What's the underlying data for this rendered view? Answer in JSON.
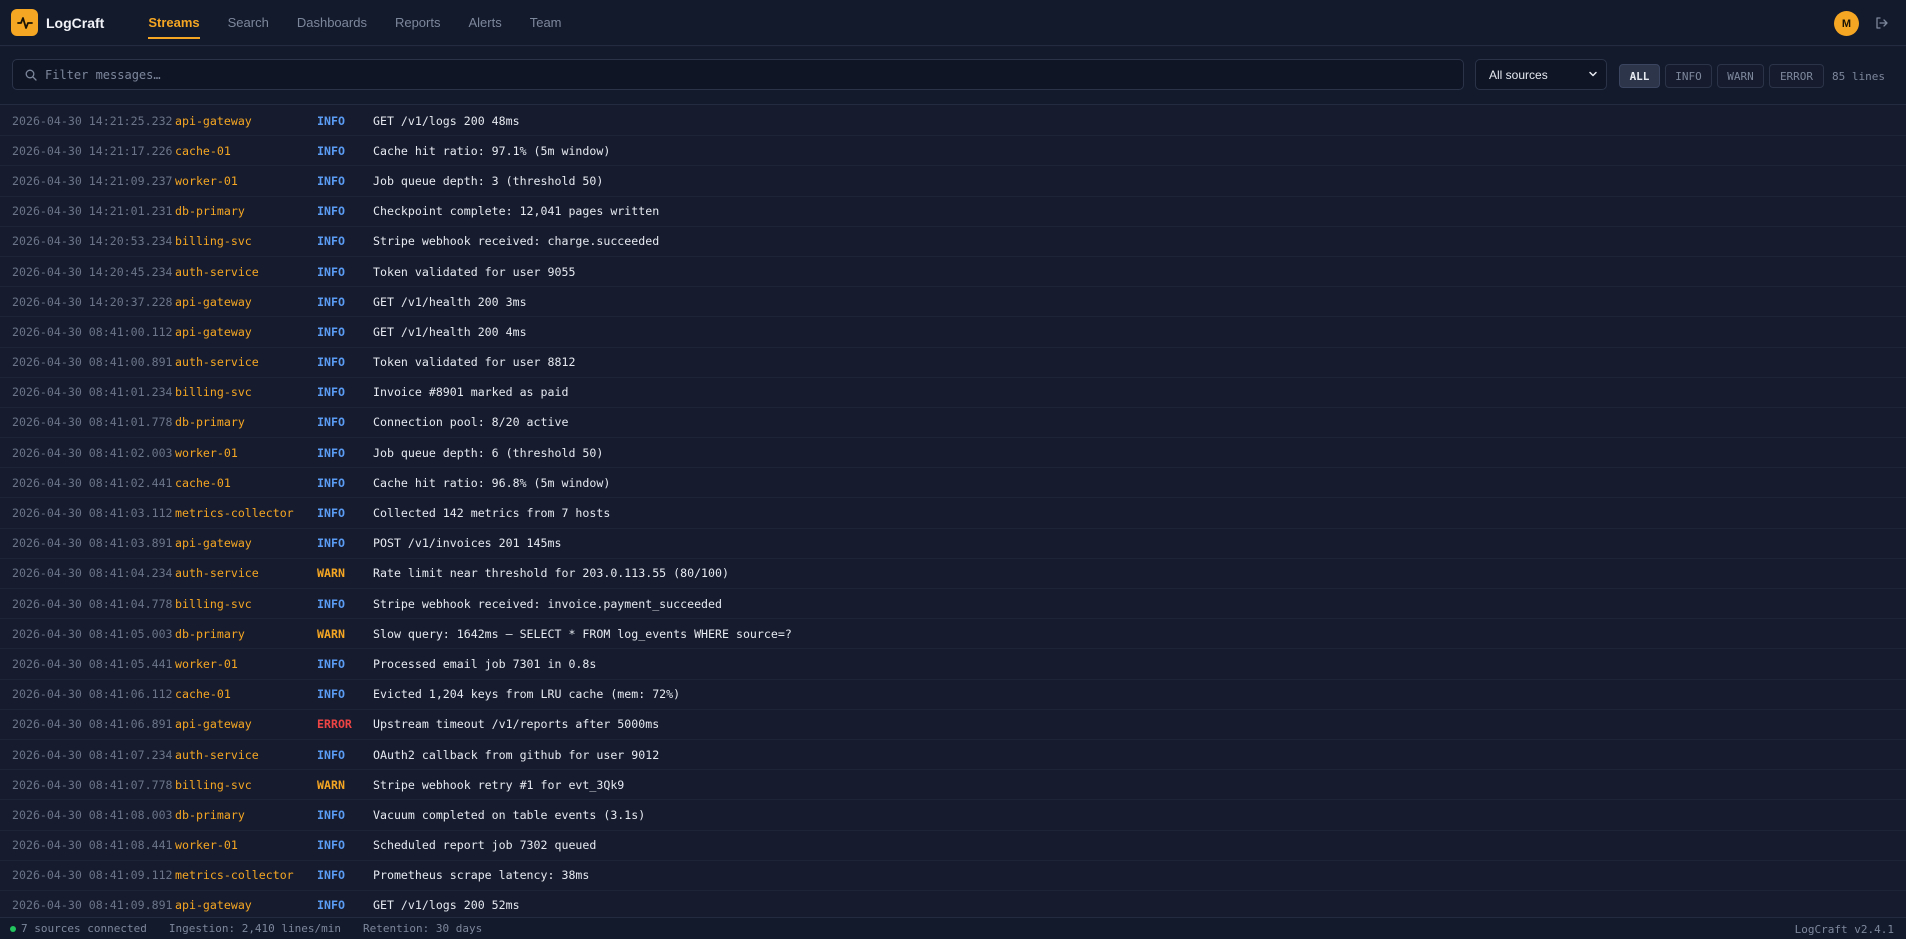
{
  "app": {
    "name": "LogCraft",
    "version": "LogCraft v2.4.1"
  },
  "nav": [
    {
      "label": "Streams",
      "active": true
    },
    {
      "label": "Search",
      "active": false
    },
    {
      "label": "Dashboards",
      "active": false
    },
    {
      "label": "Reports",
      "active": false
    },
    {
      "label": "Alerts",
      "active": false
    },
    {
      "label": "Team",
      "active": false
    }
  ],
  "user": {
    "initial": "M"
  },
  "toolbar": {
    "filter_placeholder": "Filter messages…",
    "source_selected": "All sources",
    "levels": [
      "ALL",
      "INFO",
      "WARN",
      "ERROR"
    ],
    "active_level": "ALL",
    "line_count": "85 lines"
  },
  "logs": [
    {
      "ts": "2026-04-30 14:21:25.232",
      "src": "api-gateway",
      "lvl": "INFO",
      "msg": "GET /v1/logs 200 48ms"
    },
    {
      "ts": "2026-04-30 14:21:17.226",
      "src": "cache-01",
      "lvl": "INFO",
      "msg": "Cache hit ratio: 97.1% (5m window)"
    },
    {
      "ts": "2026-04-30 14:21:09.237",
      "src": "worker-01",
      "lvl": "INFO",
      "msg": "Job queue depth: 3 (threshold 50)"
    },
    {
      "ts": "2026-04-30 14:21:01.231",
      "src": "db-primary",
      "lvl": "INFO",
      "msg": "Checkpoint complete: 12,041 pages written"
    },
    {
      "ts": "2026-04-30 14:20:53.234",
      "src": "billing-svc",
      "lvl": "INFO",
      "msg": "Stripe webhook received: charge.succeeded"
    },
    {
      "ts": "2026-04-30 14:20:45.234",
      "src": "auth-service",
      "lvl": "INFO",
      "msg": "Token validated for user 9055"
    },
    {
      "ts": "2026-04-30 14:20:37.228",
      "src": "api-gateway",
      "lvl": "INFO",
      "msg": "GET /v1/health 200 3ms"
    },
    {
      "ts": "2026-04-30 08:41:00.112",
      "src": "api-gateway",
      "lvl": "INFO",
      "msg": "GET /v1/health 200 4ms"
    },
    {
      "ts": "2026-04-30 08:41:00.891",
      "src": "auth-service",
      "lvl": "INFO",
      "msg": "Token validated for user 8812"
    },
    {
      "ts": "2026-04-30 08:41:01.234",
      "src": "billing-svc",
      "lvl": "INFO",
      "msg": "Invoice #8901 marked as paid"
    },
    {
      "ts": "2026-04-30 08:41:01.778",
      "src": "db-primary",
      "lvl": "INFO",
      "msg": "Connection pool: 8/20 active"
    },
    {
      "ts": "2026-04-30 08:41:02.003",
      "src": "worker-01",
      "lvl": "INFO",
      "msg": "Job queue depth: 6 (threshold 50)"
    },
    {
      "ts": "2026-04-30 08:41:02.441",
      "src": "cache-01",
      "lvl": "INFO",
      "msg": "Cache hit ratio: 96.8% (5m window)"
    },
    {
      "ts": "2026-04-30 08:41:03.112",
      "src": "metrics-collector",
      "lvl": "INFO",
      "msg": "Collected 142 metrics from 7 hosts"
    },
    {
      "ts": "2026-04-30 08:41:03.891",
      "src": "api-gateway",
      "lvl": "INFO",
      "msg": "POST /v1/invoices 201 145ms"
    },
    {
      "ts": "2026-04-30 08:41:04.234",
      "src": "auth-service",
      "lvl": "WARN",
      "msg": "Rate limit near threshold for 203.0.113.55 (80/100)"
    },
    {
      "ts": "2026-04-30 08:41:04.778",
      "src": "billing-svc",
      "lvl": "INFO",
      "msg": "Stripe webhook received: invoice.payment_succeeded"
    },
    {
      "ts": "2026-04-30 08:41:05.003",
      "src": "db-primary",
      "lvl": "WARN",
      "msg": "Slow query: 1642ms — SELECT * FROM log_events WHERE source=?"
    },
    {
      "ts": "2026-04-30 08:41:05.441",
      "src": "worker-01",
      "lvl": "INFO",
      "msg": "Processed email job 7301 in 0.8s"
    },
    {
      "ts": "2026-04-30 08:41:06.112",
      "src": "cache-01",
      "lvl": "INFO",
      "msg": "Evicted 1,204 keys from LRU cache (mem: 72%)"
    },
    {
      "ts": "2026-04-30 08:41:06.891",
      "src": "api-gateway",
      "lvl": "ERROR",
      "msg": "Upstream timeout /v1/reports after 5000ms"
    },
    {
      "ts": "2026-04-30 08:41:07.234",
      "src": "auth-service",
      "lvl": "INFO",
      "msg": "OAuth2 callback from github for user 9012"
    },
    {
      "ts": "2026-04-30 08:41:07.778",
      "src": "billing-svc",
      "lvl": "WARN",
      "msg": "Stripe webhook retry #1 for evt_3Qk9"
    },
    {
      "ts": "2026-04-30 08:41:08.003",
      "src": "db-primary",
      "lvl": "INFO",
      "msg": "Vacuum completed on table events (3.1s)"
    },
    {
      "ts": "2026-04-30 08:41:08.441",
      "src": "worker-01",
      "lvl": "INFO",
      "msg": "Scheduled report job 7302 queued"
    },
    {
      "ts": "2026-04-30 08:41:09.112",
      "src": "metrics-collector",
      "lvl": "INFO",
      "msg": "Prometheus scrape latency: 38ms"
    },
    {
      "ts": "2026-04-30 08:41:09.891",
      "src": "api-gateway",
      "lvl": "INFO",
      "msg": "GET /v1/logs 200 52ms"
    }
  ],
  "status": {
    "sources": "7 sources connected",
    "ingestion": "Ingestion: 2,410 lines/min",
    "retention": "Retention: 30 days"
  },
  "colors": {
    "accent": "#f5a623",
    "info": "#5b9cf5",
    "warn": "#f5a623",
    "error": "#ef4444",
    "status_ok": "#22c55e"
  }
}
